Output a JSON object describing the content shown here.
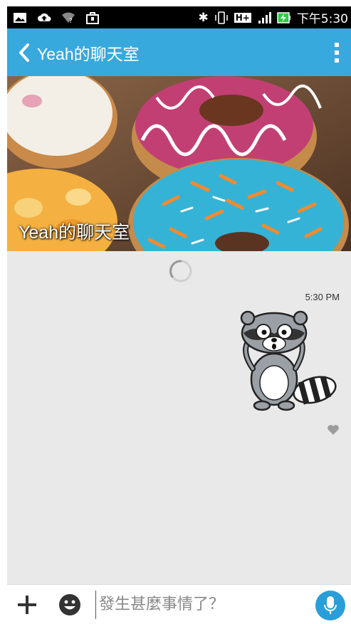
{
  "status_bar": {
    "time": "下午5:30",
    "network": "H+"
  },
  "app_bar": {
    "title": "Yeah的聊天室"
  },
  "banner": {
    "title": "Yeah的聊天室"
  },
  "chat": {
    "messages": [
      {
        "time": "5:30 PM",
        "type": "sticker",
        "sticker": "raccoon-sticker"
      }
    ]
  },
  "input": {
    "placeholder": "發生甚麼事情了？"
  },
  "colors": {
    "app_bar": "#37a9dc",
    "chat_bg": "#e9e9e9",
    "mic": "#2a9ed8"
  }
}
